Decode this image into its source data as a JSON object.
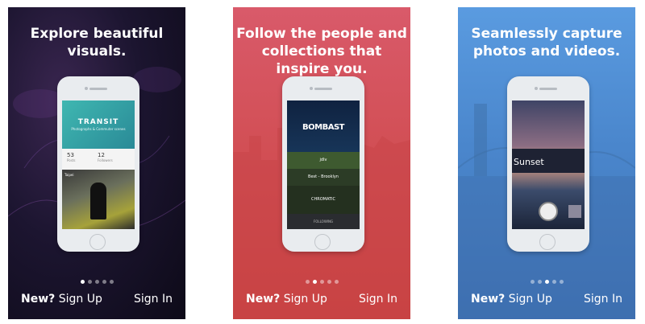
{
  "cards": [
    {
      "headline": "Explore beautiful visuals.",
      "signup_prefix": "New?",
      "signup_label": "Sign Up",
      "signin_label": "Sign In",
      "page_index": 1,
      "page_count": 5,
      "phone": {
        "title": "TRANSIT",
        "subtitle": "Photographs & Commuter scenes",
        "stat1_value": "53",
        "stat1_label": "Posts",
        "stat2_value": "12",
        "stat2_label": "Followers",
        "photo_caption": "Taipei"
      }
    },
    {
      "headline": "Follow the people and collections that inspire you.",
      "signup_prefix": "New?",
      "signup_label": "Sign Up",
      "signin_label": "Sign In",
      "page_index": 2,
      "page_count": 5,
      "phone": {
        "hero_title": "BOMBAST",
        "row1": "jdlv",
        "row2": "Best - Brooklyn",
        "row3": "CHROMATIC",
        "nav_label": "FOLLOWING"
      }
    },
    {
      "headline": "Seamlessly capture photos and videos.",
      "signup_prefix": "New?",
      "signup_label": "Sign Up",
      "signin_label": "Sign In",
      "page_index": 3,
      "page_count": 5,
      "phone": {
        "overlay_label": "Sunset"
      }
    }
  ],
  "colors": {
    "card1_bg": "#1c1530",
    "card2_bg": "#d24f55",
    "card3_bg": "#4a86cc",
    "active_dot": "#ffffff",
    "inactive_dot": "rgba(255,255,255,0.45)"
  }
}
